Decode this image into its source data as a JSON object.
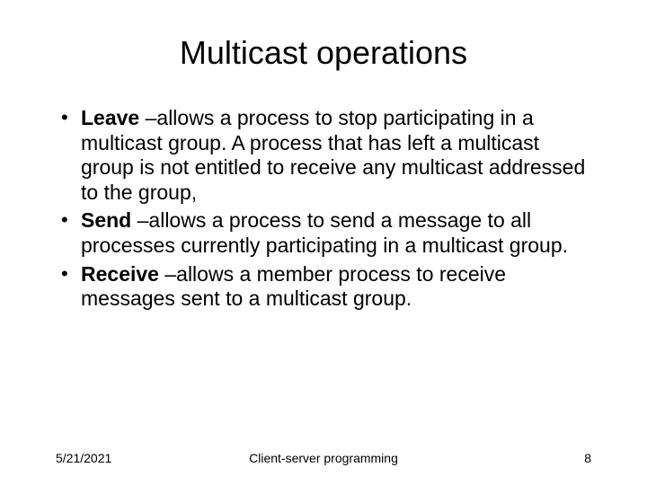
{
  "title": "Multicast operations",
  "bullets": [
    {
      "bold": "Leave ",
      "text": "–allows a process to stop participating in a multicast group.  A process that has left a multicast group is not entitled to receive any multicast addressed to the group,"
    },
    {
      "bold": "Send ",
      "text": "–allows a process to send a message to all processes currently participating in a multicast group."
    },
    {
      "bold": "Receive ",
      "text": "–allows a member process to receive messages sent to a multicast group."
    }
  ],
  "footer": {
    "date": "5/21/2021",
    "center": "Client-server programming",
    "page": "8"
  }
}
